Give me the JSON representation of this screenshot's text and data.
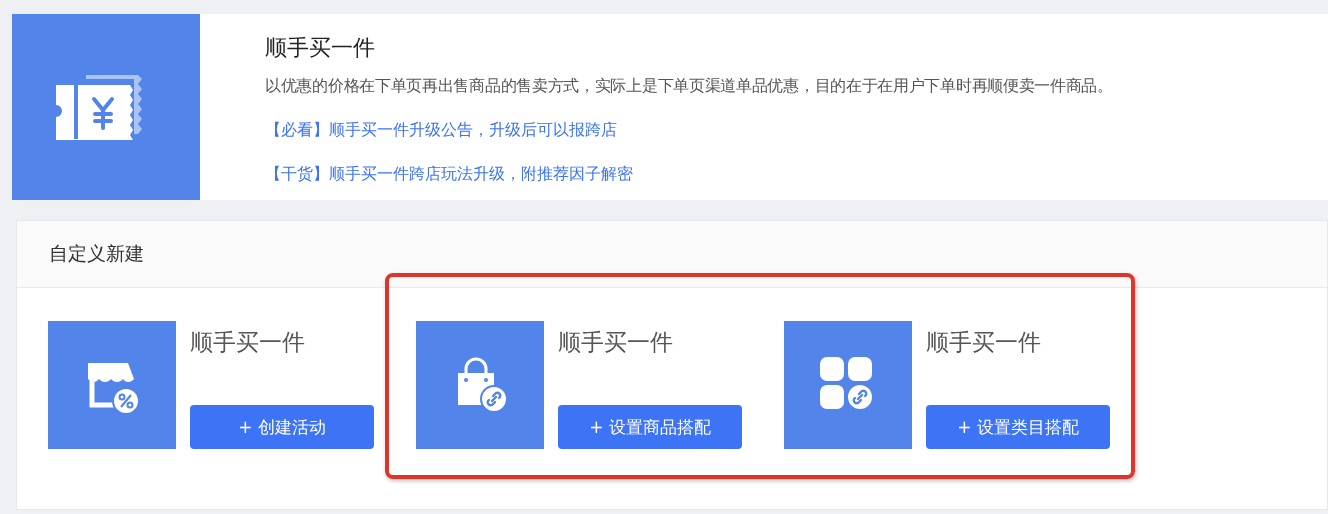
{
  "intro": {
    "title": "顺手买一件",
    "description": "以优惠的价格在下单页再出售商品的售卖方式，实际上是下单页渠道单品优惠，目的在于在用户下单时再顺便卖一件商品。",
    "links": [
      "【必看】顺手买一件升级公告，升级后可以报跨店",
      "【干货】顺手买一件跨店玩法升级，附推荐因子解密"
    ]
  },
  "custom_section": {
    "title": "自定义新建",
    "cards": [
      {
        "kind": "shop",
        "title": "顺手买一件",
        "button": "+ 创建活动",
        "highlighted": false
      },
      {
        "kind": "bag",
        "title": "顺手买一件",
        "button": "+ 设置商品搭配",
        "highlighted": true
      },
      {
        "kind": "category",
        "title": "顺手买一件",
        "button": "+ 设置类目搭配",
        "highlighted": true
      }
    ]
  }
}
